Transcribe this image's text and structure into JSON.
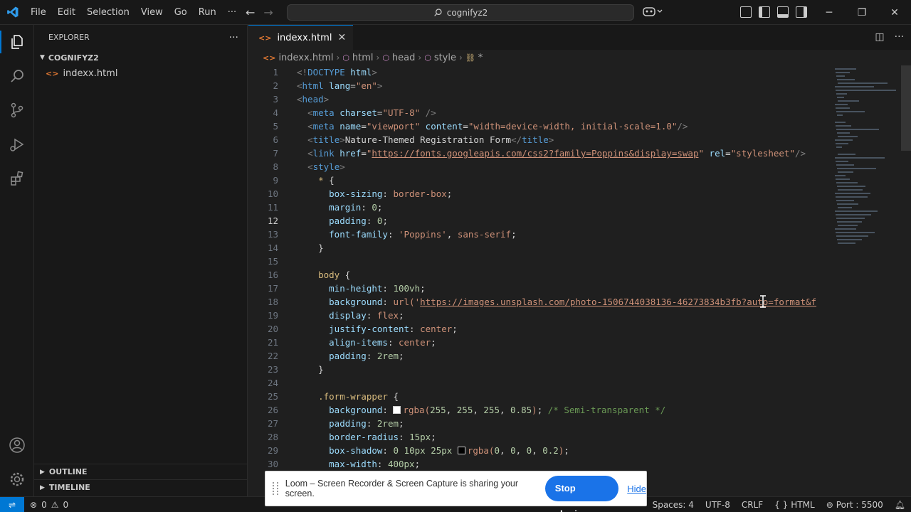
{
  "menu": [
    "File",
    "Edit",
    "Selection",
    "View",
    "Go",
    "Run",
    "···"
  ],
  "search": {
    "text": "cognifyz2"
  },
  "sidebar": {
    "title": "EXPLORER",
    "folder": "COGNIFYZ2",
    "file": "indexx.html",
    "outline": "OUTLINE",
    "timeline": "TIMELINE"
  },
  "tab": {
    "label": "indexx.html"
  },
  "breadcrumb": [
    "indexx.html",
    "html",
    "head",
    "style",
    "*"
  ],
  "code_lines": [
    {
      "n": "1",
      "html": "<span class='tag'>&lt;!</span><span class='tn'>DOCTYPE</span> <span class='attr'>html</span><span class='tag'>&gt;</span>"
    },
    {
      "n": "2",
      "html": "<span class='tag'>&lt;</span><span class='tn'>html</span> <span class='attr'>lang</span><span class='pun'>=</span><span class='str'>\"en\"</span><span class='tag'>&gt;</span>"
    },
    {
      "n": "3",
      "html": "<span class='tag'>&lt;</span><span class='tn'>head</span><span class='tag'>&gt;</span>"
    },
    {
      "n": "4",
      "html": "  <span class='tag'>&lt;</span><span class='tn'>meta</span> <span class='attr'>charset</span><span class='pun'>=</span><span class='str'>\"UTF-8\"</span> <span class='tag'>/&gt;</span>"
    },
    {
      "n": "5",
      "html": "  <span class='tag'>&lt;</span><span class='tn'>meta</span> <span class='attr'>name</span><span class='pun'>=</span><span class='str'>\"viewport\"</span> <span class='attr'>content</span><span class='pun'>=</span><span class='str'>\"width=device-width, initial-scale=1.0\"</span><span class='tag'>/&gt;</span>"
    },
    {
      "n": "6",
      "html": "  <span class='tag'>&lt;</span><span class='tn'>title</span><span class='tag'>&gt;</span><span class='pun'>Nature-Themed Registration Form</span><span class='tag'>&lt;/</span><span class='tn'>title</span><span class='tag'>&gt;</span>"
    },
    {
      "n": "7",
      "html": "  <span class='tag'>&lt;</span><span class='tn'>link</span> <span class='attr'>href</span><span class='pun'>=</span><span class='str'>\"</span><span class='lnk'>https://fonts.googleapis.com/css2?family=Poppins&amp;display=swap</span><span class='str'>\"</span> <span class='attr'>rel</span><span class='pun'>=</span><span class='str'>\"stylesheet\"</span><span class='tag'>/&gt;</span>"
    },
    {
      "n": "8",
      "html": "  <span class='tag'>&lt;</span><span class='tn'>style</span><span class='tag'>&gt;</span>"
    },
    {
      "n": "9",
      "html": "    <span class='sel'>*</span> <span class='pun'>{</span>"
    },
    {
      "n": "10",
      "html": "      <span class='prop'>box-sizing</span><span class='pun'>:</span> <span class='val'>border-box</span><span class='pun'>;</span>"
    },
    {
      "n": "11",
      "html": "      <span class='prop'>margin</span><span class='pun'>:</span> <span class='num'>0</span><span class='pun'>;</span>"
    },
    {
      "n": "12",
      "html": "      <span class='prop'>padding</span><span class='pun'>:</span> <span class='num'>0</span><span class='pun'>;</span>"
    },
    {
      "n": "13",
      "html": "      <span class='prop'>font-family</span><span class='pun'>:</span> <span class='str'>'Poppins'</span><span class='pun'>,</span> <span class='val'>sans-serif</span><span class='pun'>;</span>"
    },
    {
      "n": "14",
      "html": "    <span class='pun'>}</span>"
    },
    {
      "n": "15",
      "html": ""
    },
    {
      "n": "16",
      "html": "    <span class='sel'>body</span> <span class='pun'>{</span>"
    },
    {
      "n": "17",
      "html": "      <span class='prop'>min-height</span><span class='pun'>:</span> <span class='num'>100vh</span><span class='pun'>;</span>"
    },
    {
      "n": "18",
      "html": "      <span class='prop'>background</span><span class='pun'>:</span> <span class='val'>url(</span><span class='str'>'</span><span class='lnk'>https://images.unsplash.com/photo-1506744038136-46273834b3fb?auto=format&amp;f</span>"
    },
    {
      "n": "19",
      "html": "      <span class='prop'>display</span><span class='pun'>:</span> <span class='val'>flex</span><span class='pun'>;</span>"
    },
    {
      "n": "20",
      "html": "      <span class='prop'>justify-content</span><span class='pun'>:</span> <span class='val'>center</span><span class='pun'>;</span>"
    },
    {
      "n": "21",
      "html": "      <span class='prop'>align-items</span><span class='pun'>:</span> <span class='val'>center</span><span class='pun'>;</span>"
    },
    {
      "n": "22",
      "html": "      <span class='prop'>padding</span><span class='pun'>:</span> <span class='num'>2rem</span><span class='pun'>;</span>"
    },
    {
      "n": "23",
      "html": "    <span class='pun'>}</span>"
    },
    {
      "n": "24",
      "html": ""
    },
    {
      "n": "25",
      "html": "    <span class='sel'>.form-wrapper</span> <span class='pun'>{</span>"
    },
    {
      "n": "26",
      "html": "      <span class='prop'>background</span><span class='pun'>:</span> <span class='swatch' style='background:#ffffff'></span><span class='val'>rgba(</span><span class='num'>255</span><span class='pun'>,</span> <span class='num'>255</span><span class='pun'>,</span> <span class='num'>255</span><span class='pun'>,</span> <span class='num'>0.85</span><span class='val'>)</span><span class='pun'>;</span> <span class='cmt'>/* Semi-transparent */</span>"
    },
    {
      "n": "27",
      "html": "      <span class='prop'>padding</span><span class='pun'>:</span> <span class='num'>2rem</span><span class='pun'>;</span>"
    },
    {
      "n": "28",
      "html": "      <span class='prop'>border-radius</span><span class='pun'>:</span> <span class='num'>15px</span><span class='pun'>;</span>"
    },
    {
      "n": "29",
      "html": "      <span class='prop'>box-shadow</span><span class='pun'>:</span> <span class='num'>0</span> <span class='num'>10px</span> <span class='num'>25px</span> <span class='swatch' style='background:#000000'></span><span class='val'>rgba(</span><span class='num'>0</span><span class='pun'>,</span> <span class='num'>0</span><span class='pun'>,</span> <span class='num'>0</span><span class='pun'>,</span> <span class='num'>0.2</span><span class='val'>)</span><span class='pun'>;</span>"
    },
    {
      "n": "30",
      "html": "      <span class='prop'>max-width</span><span class='pun'>:</span> <span class='num'>400px</span><span class='pun'>;</span>"
    }
  ],
  "current_line": "12",
  "statusbar": {
    "problems": "0",
    "warnings": "0",
    "spaces": "Spaces: 4",
    "encoding": "UTF-8",
    "eol": "CRLF",
    "language": "HTML",
    "port": "Port : 5500"
  },
  "loom": {
    "message": "Loom – Screen Recorder & Screen Capture is sharing your screen.",
    "stop_label": "Stop sharing",
    "hide_label": "Hide"
  },
  "colors": {
    "accent": "#0078d4",
    "loom_button": "#1a73e8"
  }
}
